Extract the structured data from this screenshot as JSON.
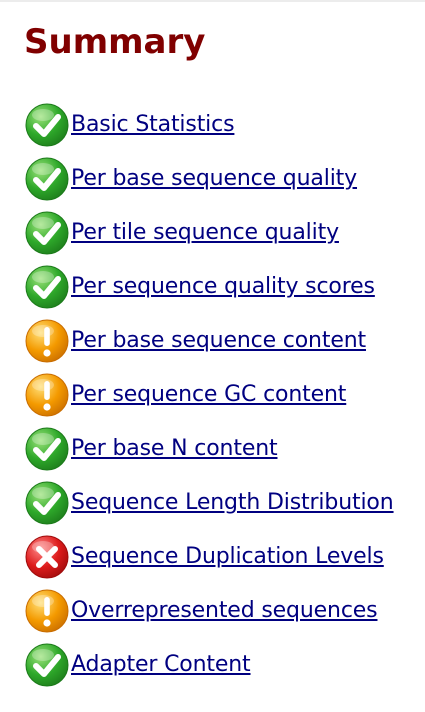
{
  "title": "Summary",
  "colors": {
    "title": "#800000",
    "link": "#000080",
    "pass": "#2ea82a",
    "warn": "#f49a00",
    "fail": "#dd1c1c"
  },
  "modules": [
    {
      "label": "Basic Statistics",
      "status": "pass",
      "icon": "tick-icon"
    },
    {
      "label": "Per base sequence quality",
      "status": "pass",
      "icon": "tick-icon"
    },
    {
      "label": "Per tile sequence quality",
      "status": "pass",
      "icon": "tick-icon"
    },
    {
      "label": "Per sequence quality scores",
      "status": "pass",
      "icon": "tick-icon"
    },
    {
      "label": "Per base sequence content",
      "status": "warn",
      "icon": "warning-icon"
    },
    {
      "label": "Per sequence GC content",
      "status": "warn",
      "icon": "warning-icon"
    },
    {
      "label": "Per base N content",
      "status": "pass",
      "icon": "tick-icon"
    },
    {
      "label": "Sequence Length Distribution",
      "status": "pass",
      "icon": "tick-icon"
    },
    {
      "label": "Sequence Duplication Levels",
      "status": "fail",
      "icon": "error-icon"
    },
    {
      "label": "Overrepresented sequences",
      "status": "warn",
      "icon": "warning-icon"
    },
    {
      "label": "Adapter Content",
      "status": "pass",
      "icon": "tick-icon"
    }
  ]
}
